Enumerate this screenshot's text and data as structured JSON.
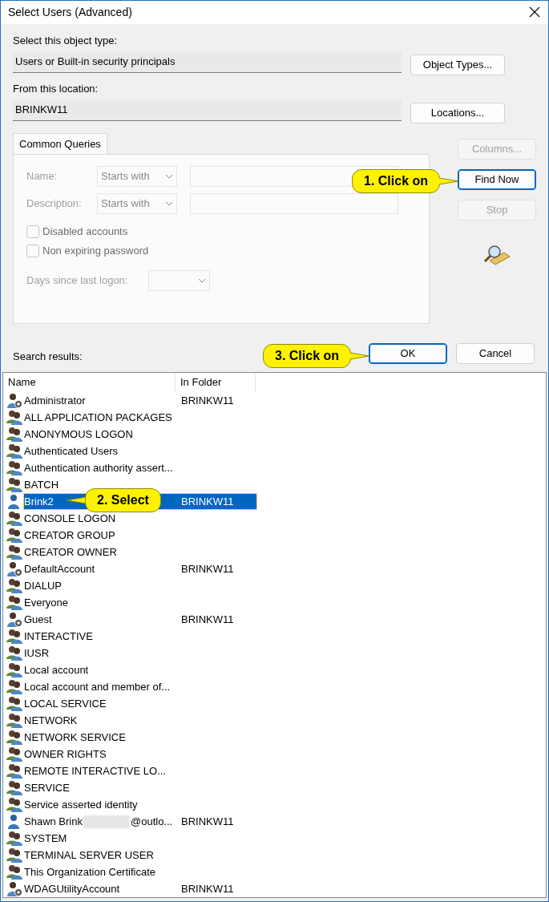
{
  "window": {
    "title": "Select Users (Advanced)"
  },
  "object_type": {
    "label": "Select this object type:",
    "value": "Users or Built-in security principals",
    "button": "Object Types..."
  },
  "location": {
    "label": "From this location:",
    "value": "BRINKW11",
    "button": "Locations..."
  },
  "tabs": [
    {
      "label": "Common Queries",
      "selected": true
    }
  ],
  "query": {
    "disabled": true,
    "fields": [
      {
        "label": "Name:",
        "operator": "Starts with"
      },
      {
        "label": "Description:",
        "operator": "Starts with"
      }
    ],
    "checkboxes": [
      {
        "label": "Disabled accounts",
        "checked": false
      },
      {
        "label": "Non expiring password",
        "checked": false
      }
    ],
    "days_label": "Days since last logon:"
  },
  "side_buttons": [
    {
      "label": "Columns...",
      "disabled": true,
      "focused": false
    },
    {
      "label": "Find Now",
      "disabled": false,
      "focused": true
    },
    {
      "label": "Stop",
      "disabled": true,
      "focused": false
    }
  ],
  "ok_button": {
    "label": "OK",
    "focused": true
  },
  "cancel_button": {
    "label": "Cancel",
    "focused": false
  },
  "results_label": "Search results:",
  "columns": [
    "Name",
    "In Folder"
  ],
  "rows": [
    {
      "kind": "local",
      "name": "Administrator",
      "folder": "BRINKW11",
      "selected": false
    },
    {
      "kind": "group",
      "name": "ALL APPLICATION PACKAGES",
      "selected": false
    },
    {
      "kind": "group",
      "name": "ANONYMOUS LOGON",
      "selected": false
    },
    {
      "kind": "group",
      "name": "Authenticated Users",
      "selected": false
    },
    {
      "kind": "group",
      "name": "Authentication authority assert...",
      "selected": false
    },
    {
      "kind": "group",
      "name": "BATCH",
      "selected": false
    },
    {
      "kind": "user",
      "name": "Brink2",
      "folder": "BRINKW11",
      "selected": true
    },
    {
      "kind": "group",
      "name": "CONSOLE LOGON",
      "selected": false
    },
    {
      "kind": "group",
      "name": "CREATOR GROUP",
      "selected": false
    },
    {
      "kind": "group",
      "name": "CREATOR OWNER",
      "selected": false
    },
    {
      "kind": "local",
      "name": "DefaultAccount",
      "folder": "BRINKW11",
      "selected": false
    },
    {
      "kind": "group",
      "name": "DIALUP",
      "selected": false
    },
    {
      "kind": "group",
      "name": "Everyone",
      "selected": false
    },
    {
      "kind": "local",
      "name": "Guest",
      "folder": "BRINKW11",
      "selected": false
    },
    {
      "kind": "group",
      "name": "INTERACTIVE",
      "selected": false
    },
    {
      "kind": "group",
      "name": "IUSR",
      "selected": false
    },
    {
      "kind": "group",
      "name": "Local account",
      "selected": false
    },
    {
      "kind": "group",
      "name": "Local account and member of...",
      "selected": false
    },
    {
      "kind": "group",
      "name": "LOCAL SERVICE",
      "selected": false
    },
    {
      "kind": "group",
      "name": "NETWORK",
      "selected": false
    },
    {
      "kind": "group",
      "name": "NETWORK SERVICE",
      "selected": false
    },
    {
      "kind": "group",
      "name": "OWNER RIGHTS",
      "selected": false
    },
    {
      "kind": "group",
      "name": "REMOTE INTERACTIVE LO...",
      "selected": false
    },
    {
      "kind": "group",
      "name": "SERVICE",
      "selected": false
    },
    {
      "kind": "group",
      "name": "Service asserted identity",
      "selected": false
    },
    {
      "kind": "user",
      "name": "Shawn Brink",
      "redacted_tail": "@outlo...",
      "folder": "BRINKW11",
      "selected": false
    },
    {
      "kind": "group",
      "name": "SYSTEM",
      "selected": false
    },
    {
      "kind": "group",
      "name": "TERMINAL SERVER USER",
      "selected": false
    },
    {
      "kind": "group",
      "name": "This Organization Certificate",
      "selected": false
    },
    {
      "kind": "local",
      "name": "WDAGUtilityAccount",
      "folder": "BRINKW11",
      "selected": false
    }
  ],
  "callouts": [
    "1. Click on",
    "2. Select",
    "3. Click on"
  ]
}
